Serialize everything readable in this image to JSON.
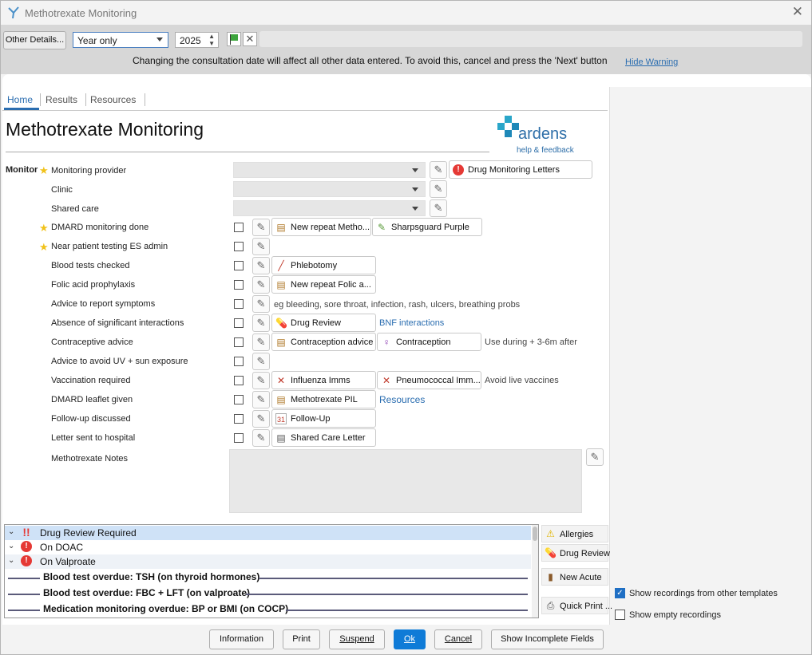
{
  "window": {
    "title": "Methotrexate Monitoring"
  },
  "toolbar": {
    "other_details": "Other Details...",
    "period_select": "Year only",
    "year": "2025",
    "warning": "Changing the consultation date will affect all other data entered. To avoid this, cancel and press the 'Next' button",
    "hide_warning": "Hide Warning"
  },
  "tabs": [
    "Home",
    "Results",
    "Resources"
  ],
  "page": {
    "title": "Methotrexate Monitoring",
    "brand": "ardens",
    "brand_sub": "help & feedback"
  },
  "section_label": "Monitor",
  "rows": {
    "monitoring_provider": "Monitoring provider",
    "clinic": "Clinic",
    "shared_care": "Shared care",
    "dmard_done": "DMARD monitoring done",
    "npt": "Near patient testing ES admin",
    "blood_tests": "Blood tests checked",
    "folic": "Folic acid prophylaxis",
    "advice_symptoms": "Advice to report symptoms",
    "interactions": "Absence of significant interactions",
    "contraceptive": "Contraceptive advice",
    "uv": "Advice to avoid UV + sun exposure",
    "vaccination": "Vaccination required",
    "leaflet": "DMARD leaflet given",
    "followup": "Follow-up discussed",
    "letter": "Letter sent to hospital",
    "notes": "Methotrexate Notes"
  },
  "actions": {
    "drug_monitoring_letters": "Drug Monitoring Letters",
    "new_repeat_metho": "New repeat Metho...",
    "sharpsguard": "Sharpsguard Purple",
    "phlebotomy": "Phlebotomy",
    "new_repeat_folic": "New repeat Folic a...",
    "drug_review": "Drug Review",
    "contraception_advice": "Contraception advice",
    "contraception": "Contraception",
    "influenza": "Influenza Imms",
    "pneumococcal": "Pneumococcal Imm...",
    "methotrexate_pil": "Methotrexate PIL",
    "follow_up": "Follow-Up",
    "shared_care_letter": "Shared Care Letter"
  },
  "hints": {
    "symptoms": "eg bleeding, sore throat, infection, rash, ulcers, breathing probs",
    "bnf": "BNF interactions",
    "contraception": "Use during + 3-6m after",
    "vaccines": "Avoid live vaccines",
    "resources": "Resources"
  },
  "alerts": [
    {
      "icon": "!!",
      "text": "Drug Review Required"
    },
    {
      "icon": "!",
      "text": "On DOAC"
    },
    {
      "icon": "!",
      "text": "On Valproate"
    }
  ],
  "overdue": [
    "Blood test overdue: TSH (on thyroid hormones)",
    "Blood test overdue: FBC + LFT (on valproate)",
    "Medication monitoring overdue: BP or BMI (on COCP)"
  ],
  "side_buttons": [
    "Allergies",
    "Drug Review",
    "New Acute",
    "Quick Print ..."
  ],
  "options": {
    "show_other": "Show recordings from other templates",
    "show_other_checked": true,
    "show_empty": "Show empty recordings",
    "show_empty_checked": false
  },
  "footer": [
    "Information",
    "Print",
    "Suspend",
    "Ok",
    "Cancel",
    "Show Incomplete Fields"
  ]
}
